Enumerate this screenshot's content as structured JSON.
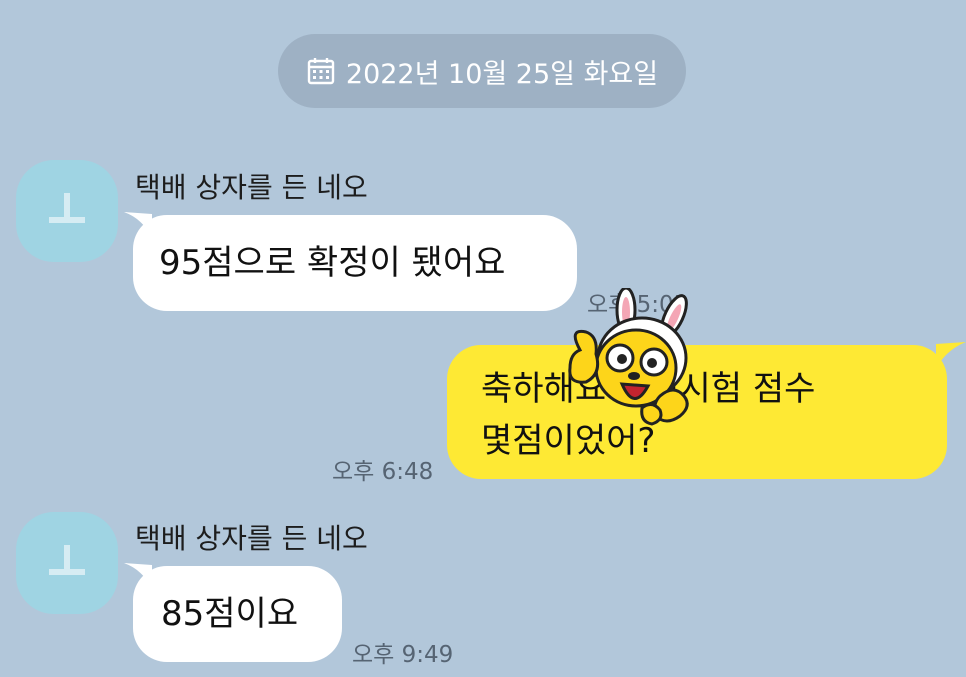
{
  "date_divider": {
    "icon": "calendar-icon",
    "text": "2022년 10월 25일 화요일"
  },
  "messages": [
    {
      "sender": "택배 상자를 든 네오",
      "text": "95점으로 확정이 됐어요",
      "time": "오후 5:05",
      "direction": "incoming"
    },
    {
      "line1": "축하해요 이전시험 점수",
      "line2": "몇점이었어?",
      "time": "오후 6:48",
      "direction": "outgoing"
    },
    {
      "sender": "택배 상자를 든 네오",
      "text": "85점이요",
      "time": "오후 9:49",
      "direction": "incoming"
    }
  ],
  "colors": {
    "background": "#b2c7da",
    "incoming_bubble": "#ffffff",
    "outgoing_bubble": "#fee934",
    "date_pill": "#9eb1c4",
    "avatar": "#9fd4e3"
  },
  "sticker": {
    "icon": "muzi-bunny-sticker-icon"
  }
}
